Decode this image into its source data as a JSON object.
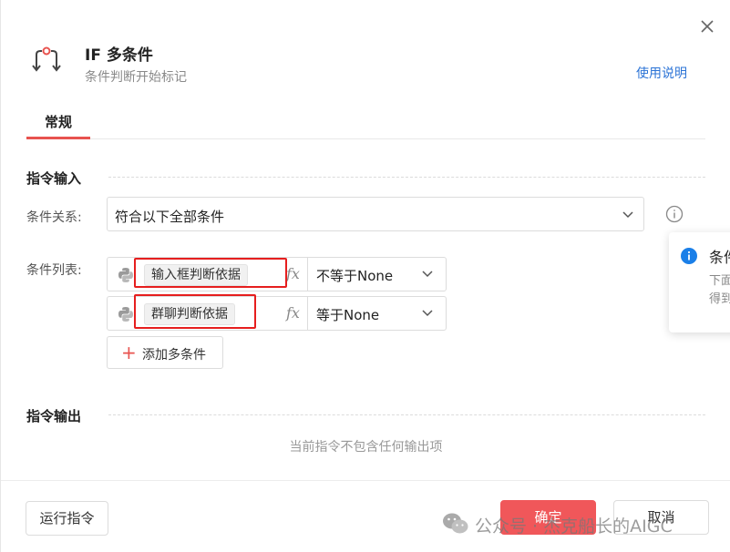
{
  "header": {
    "title": "IF 多条件",
    "subtitle": "条件判断开始标记",
    "help_link": "使用说明",
    "icon": "if-branch-icon"
  },
  "tabs": [
    {
      "label": "常规",
      "active": true
    }
  ],
  "input_section": {
    "title": "指令输入",
    "relation": {
      "label": "条件关系:",
      "value": "符合以下全部条件"
    },
    "conditions": {
      "label": "条件列表:",
      "rows": [
        {
          "variable": "输入框判断依据",
          "fx": "fx",
          "operator": "不等于None",
          "highlighted": true
        },
        {
          "variable": "群聊判断依据",
          "fx": "fx",
          "operator": "等于None",
          "highlighted": true
        }
      ],
      "add_label": "添加多条件"
    }
  },
  "output_section": {
    "title": "指令输出",
    "empty_text": "当前指令不包含任何输出项"
  },
  "popover": {
    "title": "条件",
    "desc1": "下面",
    "desc2": "得到"
  },
  "footer": {
    "run_label": "运行指令",
    "ok_label": "确定",
    "cancel_label": "取消"
  },
  "watermark": {
    "text": "公众号 · 杰克船长的AIGC"
  },
  "colors": {
    "accent": "#f0575a",
    "link": "#2b73d6",
    "highlight_box": "#e61e1e",
    "info": "#1a7fe8"
  }
}
